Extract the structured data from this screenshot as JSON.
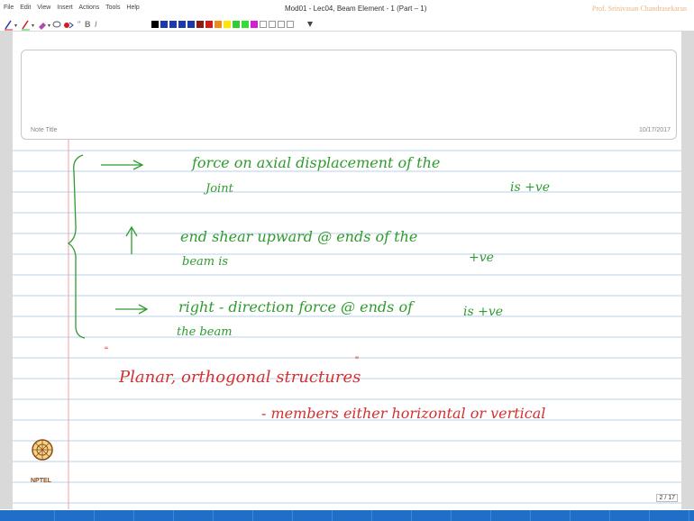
{
  "menubar": {
    "items": [
      "File",
      "Edit",
      "View",
      "Insert",
      "Actions",
      "Tools",
      "Help"
    ],
    "title": "Mod01 - Lec04, Beam Element - 1 (Part – 1)",
    "author": "Prof. Srinivasan Chandrasekaran"
  },
  "toolbar": {
    "bold": "B",
    "italic": "I",
    "quote": "\"",
    "colors": [
      "#000000",
      "#1b3aa8",
      "#1b3aa8",
      "#1b3aa8",
      "#1b3aa8",
      "#8b1a1a",
      "#d01c1c",
      "#f08a1a",
      "#ffe600",
      "#33cc33",
      "#33dd33",
      "#d020d0",
      "#ffffff",
      "#ffffff",
      "#ffffff",
      "#ffffff"
    ]
  },
  "note": {
    "title_label": "Note Title",
    "date": "10/17/2017"
  },
  "notes": {
    "line1": "force on axial displacement of the",
    "line1b": "Joint",
    "line1_sign": "is +ve",
    "line2": "end shear upward @ ends of the",
    "line2b": "beam is",
    "line2_sign": "+ve",
    "line3": "right - direction force @ ends of",
    "line3b": "the beam",
    "line3_sign": "is +ve",
    "planar": "Planar, orthogonal structures",
    "members": "- members either horizontal or vertical"
  },
  "branding": {
    "logo_text": "NPTEL"
  },
  "page": {
    "indicator": "2 / 17"
  },
  "colors": {
    "ink_green": "#2f9b2f",
    "ink_red": "#d33030",
    "rule_blue": "#b9d3ea",
    "margin_red": "#f2a0a0"
  }
}
